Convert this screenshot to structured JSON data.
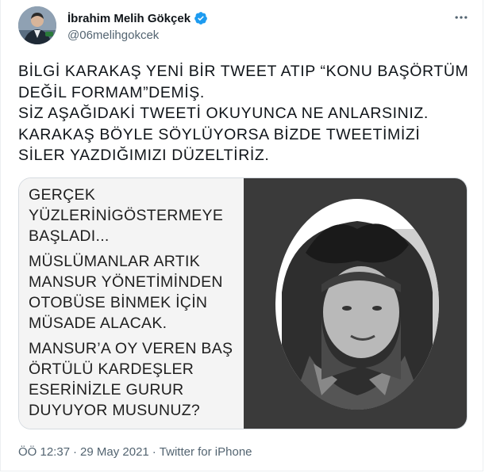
{
  "author": {
    "name": "İbrahim Melih Gökçek",
    "handle": "@06melihgokcek",
    "verified": true
  },
  "tweet": {
    "text": "BİLGİ KARAKAŞ YENİ BİR TWEET ATIP “KONU BAŞÖRTÜM DEĞİL FORMAM”DEMİŞ.\nSİZ AŞAĞIDAKİ TWEETİ OKUYUNCA NE ANLARSINIZ.\nKARAKAŞ BÖYLE SÖYLÜYORSA BİZDE TWEETİMİZİ SİLER YAZDIĞIMIZI DÜZELTİRİZ."
  },
  "media": {
    "screenshot_paragraphs": [
      "GERÇEK YÜZLERİNİGÖSTERMEYE BAŞLADI...",
      "MÜSLÜMANLAR ARTIK MANSUR YÖNETİMİNDEN OTOBÜSE BİNMEK İÇİN MÜSADE ALACAK.",
      "MANSUR’A OY VEREN BAŞ ÖRTÜLÜ KARDEŞLER ESERİNİZLE GURUR DUYUYOR MUSUNUZ?"
    ]
  },
  "meta": {
    "time": "ÖÖ 12:37",
    "separator": "·",
    "date": "29 May 2021",
    "source": "Twitter for iPhone"
  },
  "colors": {
    "verified": "#1d9bf0",
    "text": "#0f1419",
    "secondary": "#536471"
  },
  "icons": {
    "more": "more-icon",
    "verified": "verified-badge-icon"
  }
}
